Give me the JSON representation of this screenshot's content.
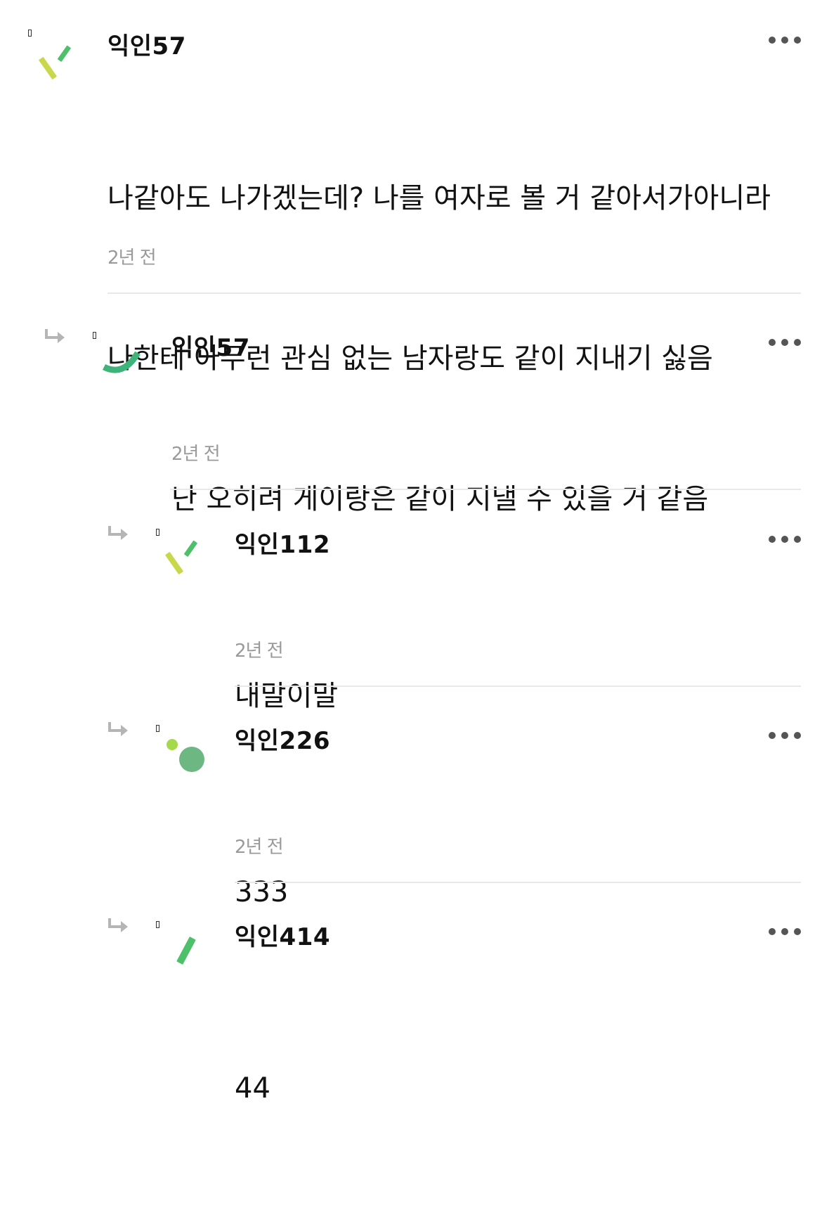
{
  "comments": [
    {
      "author": "익인57",
      "lines": [
        "나같아도 나가겠는데? 나를 여자로 볼 거 같아서가아니라",
        "나한테 아무런 관심 없는 남자랑도 같이 지내기 싫음"
      ],
      "time": "2년 전",
      "avatar_icon": "confetti-icon"
    },
    {
      "author": "익인57",
      "lines": [
        "난 오히려 게이랑은 같이 지낼 수 있을 거 같음"
      ],
      "time": "2년 전",
      "avatar_icon": "arc-icon"
    },
    {
      "author": "익인112",
      "lines": [
        "내말이말"
      ],
      "time": "2년 전",
      "avatar_icon": "confetti-icon"
    },
    {
      "author": "익인226",
      "lines": [
        "333"
      ],
      "time": "2년 전",
      "avatar_icon": "dots-icon"
    },
    {
      "author": "익인414",
      "lines": [
        "44"
      ],
      "time": "",
      "avatar_icon": "bar-icon"
    }
  ],
  "colors": {
    "green": "#4fc06a",
    "lime": "#c8d84a",
    "teal_green": "#3fb47a",
    "dot_light": "#a6d94a",
    "dot_dark": "#6cb782",
    "arrow": "#b5b5b5",
    "time": "#9a9a9a",
    "divider": "#e8e8e8"
  }
}
